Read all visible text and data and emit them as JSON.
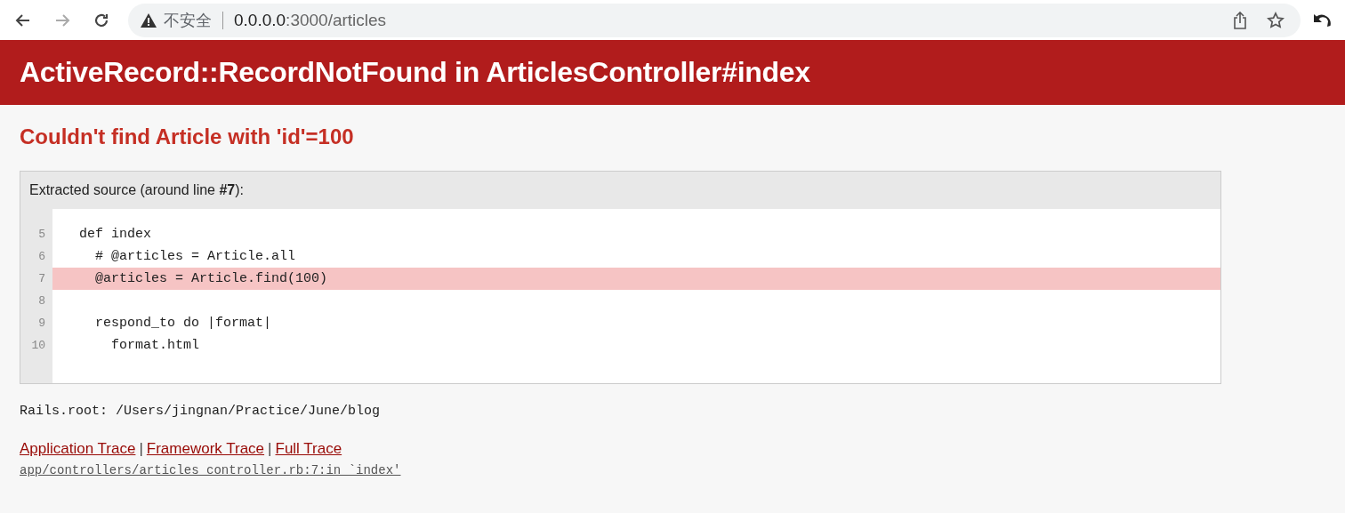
{
  "browser": {
    "back": {
      "disabled": false
    },
    "forward": {
      "disabled": true
    },
    "security_label": "不安全",
    "url_host": "0.0.0.0",
    "url_path": ":3000/articles"
  },
  "error_title": "ActiveRecord::RecordNotFound in ArticlesController#index",
  "message": "Couldn't find Article with 'id'=100",
  "source": {
    "heading": "Extracted source (around line **#7**):",
    "lines": [
      {
        "number": "5",
        "code": "  def index",
        "highlighted": false
      },
      {
        "number": "6",
        "code": "    # @articles = Article.all",
        "highlighted": false
      },
      {
        "number": "7",
        "code": "    @articles = Article.find(100)",
        "highlighted": true
      },
      {
        "number": "8",
        "highlighted": false
      },
      {
        "number": "9",
        "code": "    respond_to do |format|",
        "highlighted": false
      },
      {
        "number": "10",
        "code": "      format.html",
        "highlighted": false
      }
    ]
  },
  "rails_root": "Rails.root: /Users/jingnan/Practice/June/blog",
  "trace_links": [
    {
      "label": "Application Trace"
    },
    {
      "label": "Framework Trace"
    },
    {
      "label": "Full Trace"
    }
  ],
  "trace_separator": "|",
  "trace_line": "app/controllers/articles_controller.rb:7:in `index'"
}
